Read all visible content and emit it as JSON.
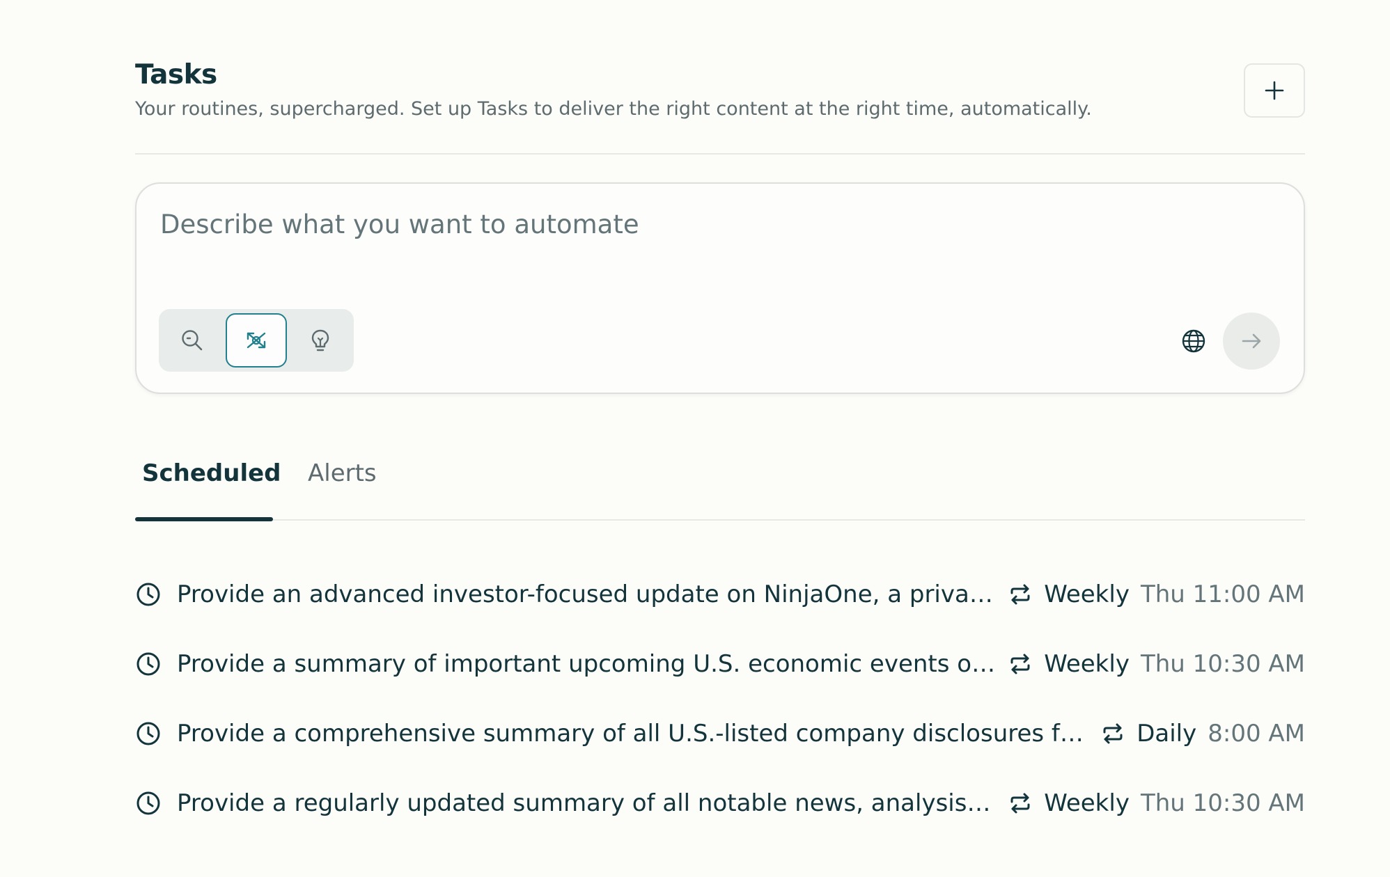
{
  "header": {
    "title": "Tasks",
    "subtitle": "Your routines, supercharged. Set up Tasks to deliver the right content at the right time, automatically.",
    "add_icon": "plus-icon"
  },
  "composer": {
    "placeholder": "Describe what you want to automate",
    "modes": [
      {
        "icon": "search-icon",
        "active": false
      },
      {
        "icon": "research-icon",
        "active": true
      },
      {
        "icon": "lightbulb-icon",
        "active": false
      }
    ],
    "globe_icon": "globe-icon",
    "submit_icon": "arrow-right-icon"
  },
  "tabs": {
    "scheduled": "Scheduled",
    "alerts": "Alerts",
    "active": "scheduled"
  },
  "tasks": [
    {
      "description": "Provide an advanced investor-focused update on NinjaOne, a privately h...",
      "frequency": "Weekly",
      "time": "Thu 11:00 AM"
    },
    {
      "description": "Provide a summary of important upcoming U.S. economic events over th...",
      "frequency": "Weekly",
      "time": "Thu 10:30 AM"
    },
    {
      "description": "Provide a comprehensive summary of all U.S.-listed company disclosures from t...",
      "frequency": "Daily",
      "time": "8:00 AM"
    },
    {
      "description": "Provide a regularly updated summary of all notable news, analysis, and i...",
      "frequency": "Weekly",
      "time": "Thu 10:30 AM"
    }
  ],
  "colors": {
    "background": "#fcfcf9",
    "text": "#13343b",
    "muted": "#64757a",
    "accent": "#21808d"
  }
}
